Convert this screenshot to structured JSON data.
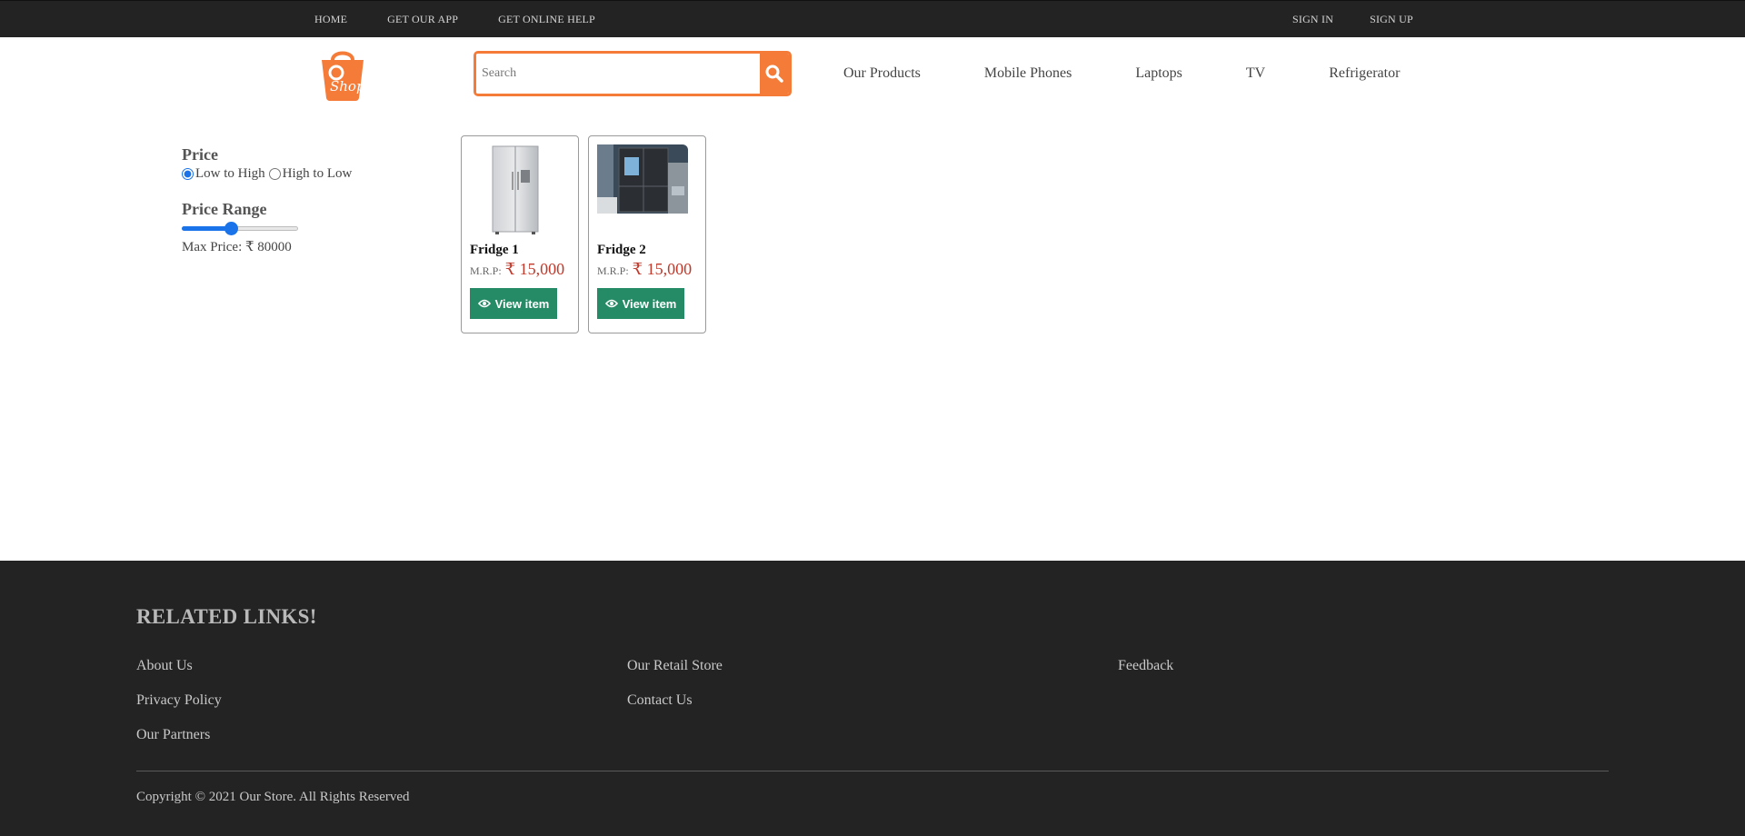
{
  "topbar": {
    "left_links": [
      "HOME",
      "GET OUR APP",
      "GET ONLINE HELP"
    ],
    "right_links": [
      "SIGN IN",
      "SIGN UP"
    ]
  },
  "header": {
    "logo_icon": "shopping-bag-logo-icon",
    "search": {
      "placeholder": "Search",
      "value": ""
    },
    "nav_items": [
      "Our Products",
      "Mobile Phones",
      "Laptops",
      "TV",
      "Refrigerator"
    ]
  },
  "filters": {
    "price_title": "Price",
    "sort_options": [
      {
        "label": "Low to High",
        "checked": true
      },
      {
        "label": "High to Low",
        "checked": false
      }
    ],
    "range_title": "Price Range",
    "range_fraction": 0.42,
    "max_price_label": "Max Price: ₹ 80000"
  },
  "products": [
    {
      "name": "Fridge 1",
      "mrp_label": "M.R.P:",
      "price": "₹ 15,000",
      "button_label": "View item"
    },
    {
      "name": "Fridge 2",
      "mrp_label": "M.R.P:",
      "price": "₹ 15,000",
      "button_label": "View item"
    }
  ],
  "footer": {
    "title": "RELATED LINKS!",
    "columns": [
      [
        "About Us",
        "Privacy Policy",
        "Our Partners"
      ],
      [
        "Our Retail Store",
        "Contact Us"
      ],
      [
        "Feedback"
      ]
    ],
    "copyright": "Copyright © 2021 Our Store. All Rights Reserved"
  },
  "colors": {
    "accent": "#f47b38",
    "dark_bar": "#232323",
    "button_green": "#258b66",
    "price_red": "#c0392b",
    "slider_blue": "#1a73e8"
  }
}
